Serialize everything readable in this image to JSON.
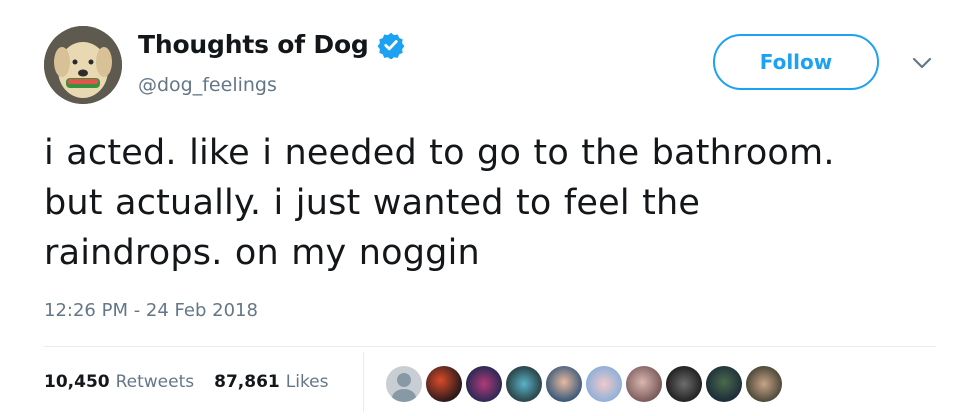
{
  "user": {
    "display_name": "Thoughts of Dog",
    "handle": "@dog_feelings",
    "verified": true,
    "avatar_icon": "dog-avatar"
  },
  "follow_button": {
    "label": "Follow"
  },
  "menu_icon": "chevron-down-icon",
  "tweet": {
    "lines": [
      "i acted. like i needed to go to the bathroom.",
      "but actually. i just wanted to feel the",
      "raindrops. on my noggin"
    ]
  },
  "timestamp": "12:26 PM - 24 Feb 2018",
  "stats": {
    "retweets": {
      "count": "10,450",
      "label": "Retweets"
    },
    "likes": {
      "count": "87,861",
      "label": "Likes"
    }
  },
  "colors": {
    "accent": "#1da1f2",
    "secondary_text": "#657786",
    "primary_text": "#14171a",
    "divider": "#e6ecf0"
  }
}
